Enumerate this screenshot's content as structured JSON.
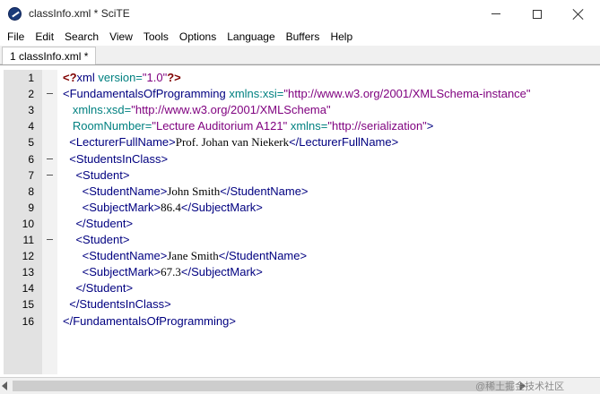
{
  "window": {
    "title": "classInfo.xml * SciTE"
  },
  "menu": [
    "File",
    "Edit",
    "Search",
    "View",
    "Tools",
    "Options",
    "Language",
    "Buffers",
    "Help"
  ],
  "tabs": [
    {
      "label": "1 classInfo.xml *"
    }
  ],
  "editor": {
    "lines": [
      {
        "no": "1",
        "fold": "",
        "segments": [
          {
            "t": "<?",
            "c": "pi"
          },
          {
            "t": "xml ",
            "c": "tag"
          },
          {
            "t": "version=",
            "c": "attr"
          },
          {
            "t": "\"1.0\"",
            "c": "val"
          },
          {
            "t": "?>",
            "c": "pi"
          }
        ]
      },
      {
        "no": "2",
        "fold": "-",
        "segments": [
          {
            "t": "<FundamentalsOfProgramming ",
            "c": "tag"
          },
          {
            "t": "xmlns:xsi=",
            "c": "attr"
          },
          {
            "t": "\"http://www.w3.org/2001/XMLSchema-instance\"",
            "c": "val"
          }
        ]
      },
      {
        "no": "3",
        "fold": "",
        "segments": [
          {
            "t": "   xmlns:xsd=",
            "c": "attr"
          },
          {
            "t": "\"http://www.w3.org/2001/XMLSchema\"",
            "c": "val"
          }
        ]
      },
      {
        "no": "4",
        "fold": "",
        "segments": [
          {
            "t": "   RoomNumber=",
            "c": "attr"
          },
          {
            "t": "\"Lecture Auditorium A121\" ",
            "c": "val"
          },
          {
            "t": "xmlns=",
            "c": "attr"
          },
          {
            "t": "\"http://serialization\"",
            "c": "val"
          },
          {
            "t": ">",
            "c": "tag"
          }
        ]
      },
      {
        "no": "5",
        "fold": "",
        "segments": [
          {
            "t": "  <LecturerFullName>",
            "c": "tag"
          },
          {
            "t": "Prof. Johan van Niekerk",
            "c": "txt"
          },
          {
            "t": "</LecturerFullName>",
            "c": "tag"
          }
        ]
      },
      {
        "no": "6",
        "fold": "-",
        "segments": [
          {
            "t": "  <StudentsInClass>",
            "c": "tag"
          }
        ]
      },
      {
        "no": "7",
        "fold": "-",
        "segments": [
          {
            "t": "    <Student>",
            "c": "tag"
          }
        ]
      },
      {
        "no": "8",
        "fold": "",
        "segments": [
          {
            "t": "      <StudentName>",
            "c": "tag"
          },
          {
            "t": "John Smith",
            "c": "txt"
          },
          {
            "t": "</StudentName>",
            "c": "tag"
          }
        ]
      },
      {
        "no": "9",
        "fold": "",
        "segments": [
          {
            "t": "      <SubjectMark>",
            "c": "tag"
          },
          {
            "t": "86.4",
            "c": "txt"
          },
          {
            "t": "</SubjectMark>",
            "c": "tag"
          }
        ]
      },
      {
        "no": "10",
        "fold": "",
        "segments": [
          {
            "t": "    </Student>",
            "c": "tag"
          }
        ]
      },
      {
        "no": "11",
        "fold": "-",
        "segments": [
          {
            "t": "    <Student>",
            "c": "tag"
          }
        ]
      },
      {
        "no": "12",
        "fold": "",
        "segments": [
          {
            "t": "      <StudentName>",
            "c": "tag"
          },
          {
            "t": "Jane Smith",
            "c": "txt"
          },
          {
            "t": "</StudentName>",
            "c": "tag"
          }
        ]
      },
      {
        "no": "13",
        "fold": "",
        "segments": [
          {
            "t": "      <SubjectMark>",
            "c": "tag"
          },
          {
            "t": "67.3",
            "c": "txt"
          },
          {
            "t": "</SubjectMark>",
            "c": "tag"
          }
        ]
      },
      {
        "no": "14",
        "fold": "",
        "segments": [
          {
            "t": "    </Student>",
            "c": "tag"
          }
        ]
      },
      {
        "no": "15",
        "fold": "",
        "segments": [
          {
            "t": "  </StudentsInClass>",
            "c": "tag"
          }
        ]
      },
      {
        "no": "16",
        "fold": "",
        "segments": [
          {
            "t": "</FundamentalsOfProgramming>",
            "c": "tag"
          }
        ]
      }
    ]
  },
  "watermark": "@稀土掘金技术社区",
  "colors": {
    "tag": "#000080",
    "attribute": "#008080",
    "value": "#7f007f",
    "processing_instruction": "#7f0000",
    "line_number_margin": "#e2e2e2"
  }
}
